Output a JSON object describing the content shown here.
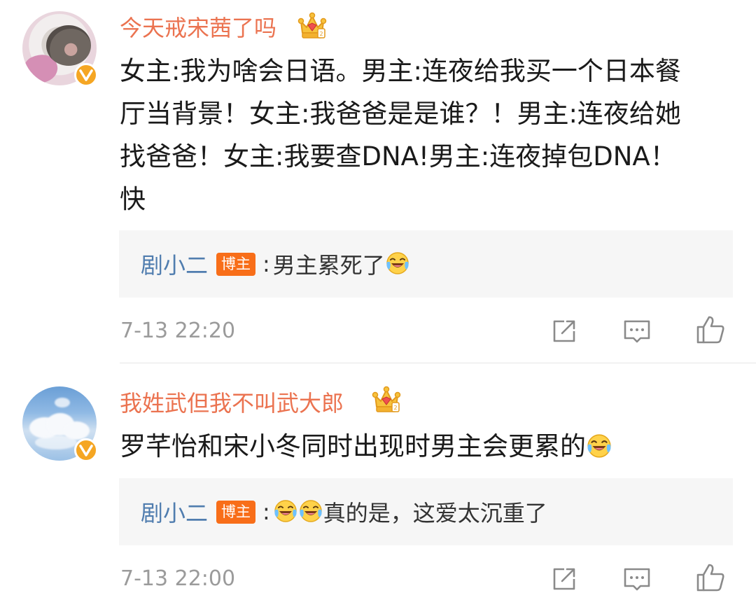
{
  "comments": [
    {
      "username": "今天戒宋茜了吗",
      "text_lines": [
        "女主:我为啥会日语。男主:连夜给我买一个日本餐",
        "厅当背景！女主:我爸爸是是谁？！男主:连夜给她",
        "找爸爸！女主:我要查DNA!男主:连夜掉包DNA！",
        "快"
      ],
      "reply": {
        "author": "剧小二",
        "badge": "博主",
        "separator": ":",
        "text": "男主累死了"
      },
      "timestamp": "7-13 22:20"
    },
    {
      "username": "我姓武但我不叫武大郎",
      "text_lines": [
        "罗芊怡和宋小冬同时出现时男主会更累的"
      ],
      "reply": {
        "author": "剧小二",
        "badge": "博主",
        "separator": ":",
        "text": "真的是，这爱太沉重了"
      },
      "timestamp": "7-13 22:00"
    }
  ],
  "colors": {
    "username": "#eb7350",
    "reply_author": "#507daf",
    "badge_bg": "#f86e19",
    "verified": "#f5a623",
    "timestamp": "#9b9b9b",
    "reply_bg": "#f6f6f6"
  },
  "icons": {
    "verified": "verified-v-icon",
    "crown": "crown-icon",
    "emoji": "laughing-crying-emoji-icon",
    "share": "share-icon",
    "comment": "comment-icon",
    "like": "thumbs-up-icon"
  }
}
